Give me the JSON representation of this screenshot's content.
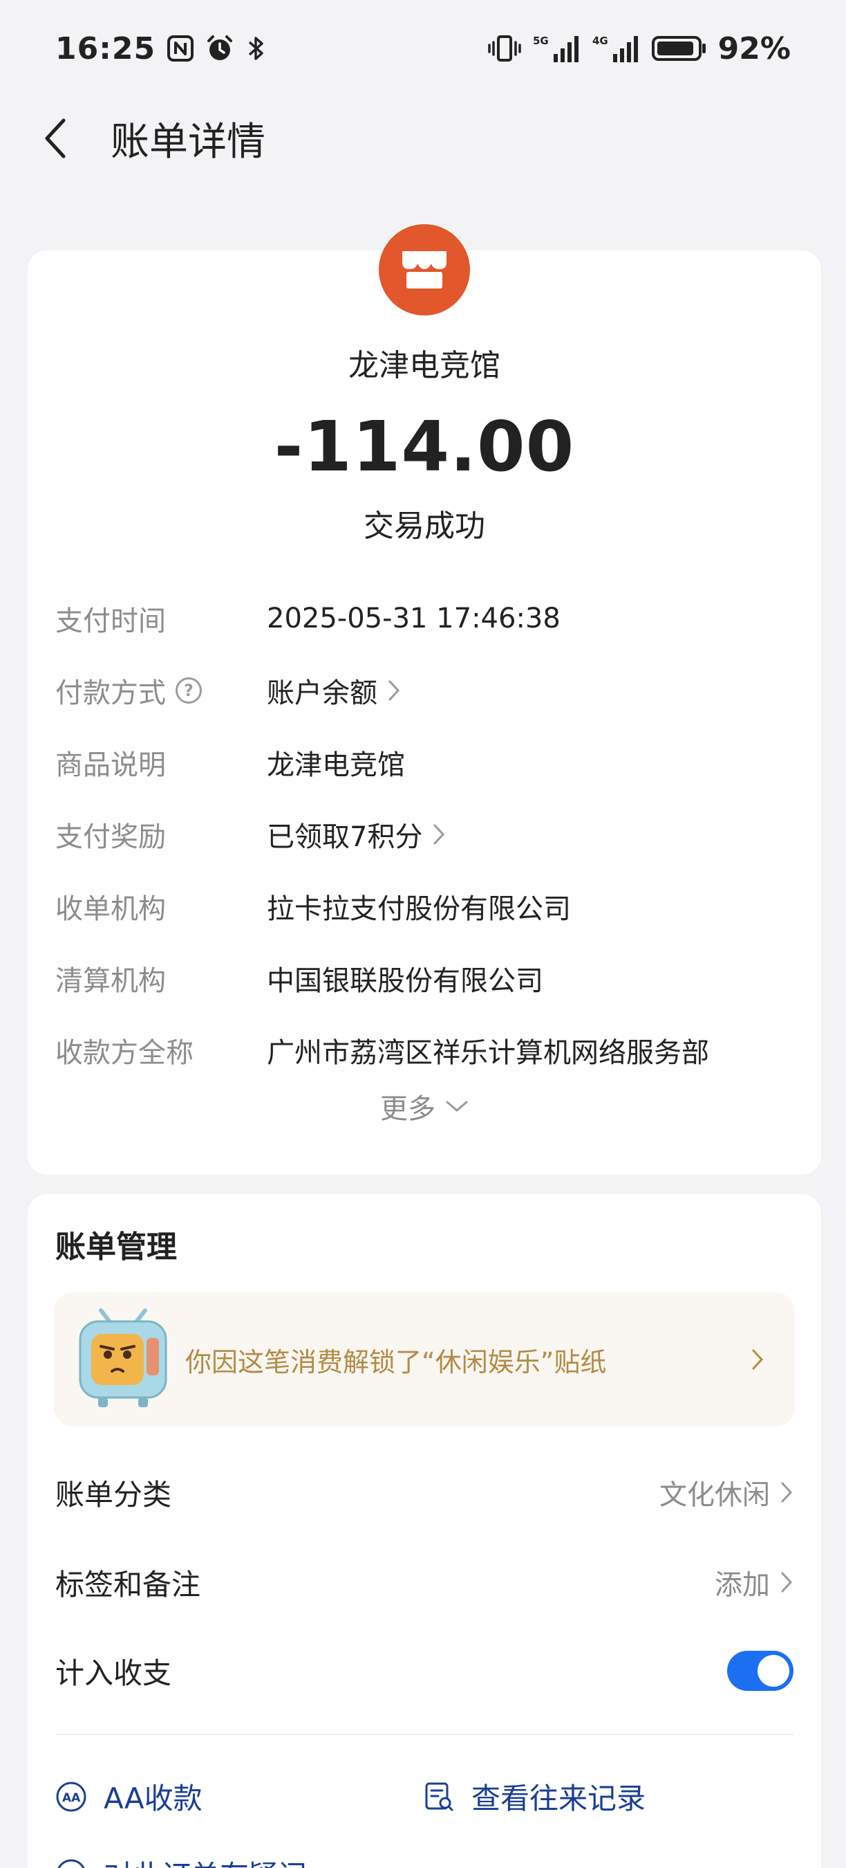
{
  "status_bar": {
    "time": "16:25",
    "battery_percent": "92%",
    "battery_level": 0.92
  },
  "header": {
    "title": "账单详情"
  },
  "transaction": {
    "merchant_name": "龙津电竞馆",
    "amount": "-114.00",
    "status": "交易成功",
    "logo_color": "#e2572b"
  },
  "details": [
    {
      "label": "支付时间",
      "value": "2025-05-31 17:46:38"
    },
    {
      "label": "付款方式",
      "value": "账户余额"
    },
    {
      "label": "商品说明",
      "value": "龙津电竞馆"
    },
    {
      "label": "支付奖励",
      "value": "已领取7积分"
    },
    {
      "label": "收单机构",
      "value": "拉卡拉支付股份有限公司"
    },
    {
      "label": "清算机构",
      "value": "中国银联股份有限公司"
    },
    {
      "label": "收款方全称",
      "value": "广州市荔湾区祥乐计算机网络服务部"
    }
  ],
  "more_label": "更多",
  "manage": {
    "title": "账单管理",
    "sticker_text": "你因这笔消费解锁了“休闲娱乐”贴纸",
    "category_label": "账单分类",
    "category_value": "文化休闲",
    "tags_label": "标签和备注",
    "tags_value": "添加",
    "include_label": "计入收支",
    "include_enabled": true,
    "aa_label": "AA收款",
    "history_label": "查看往来记录",
    "question_label": "对此订单有疑问"
  },
  "colors": {
    "accent": "#1d6ff2",
    "link": "#1a3e93",
    "sticker_text": "#b38b46",
    "background": "#f3f3f5"
  }
}
